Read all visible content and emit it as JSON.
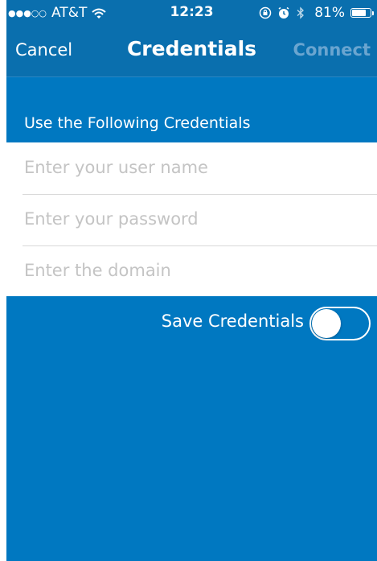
{
  "status_bar": {
    "signal": "●●●○○",
    "carrier": "AT&T",
    "time": "12:23",
    "battery_percent": "81%",
    "battery_level": 0.81
  },
  "nav": {
    "cancel_label": "Cancel",
    "title": "Credentials",
    "connect_label": "Connect"
  },
  "form": {
    "section_title": "Use the Following Credentials",
    "username": {
      "value": "",
      "placeholder": "Enter your user name"
    },
    "password": {
      "value": "",
      "placeholder": "Enter your password"
    },
    "domain": {
      "value": "",
      "placeholder": "Enter the domain"
    }
  },
  "save": {
    "label": "Save Credentials",
    "enabled": false
  },
  "colors": {
    "background": "#0078c1",
    "bar": "#0a6fae",
    "connect_disabled": "#6aa5d0"
  }
}
